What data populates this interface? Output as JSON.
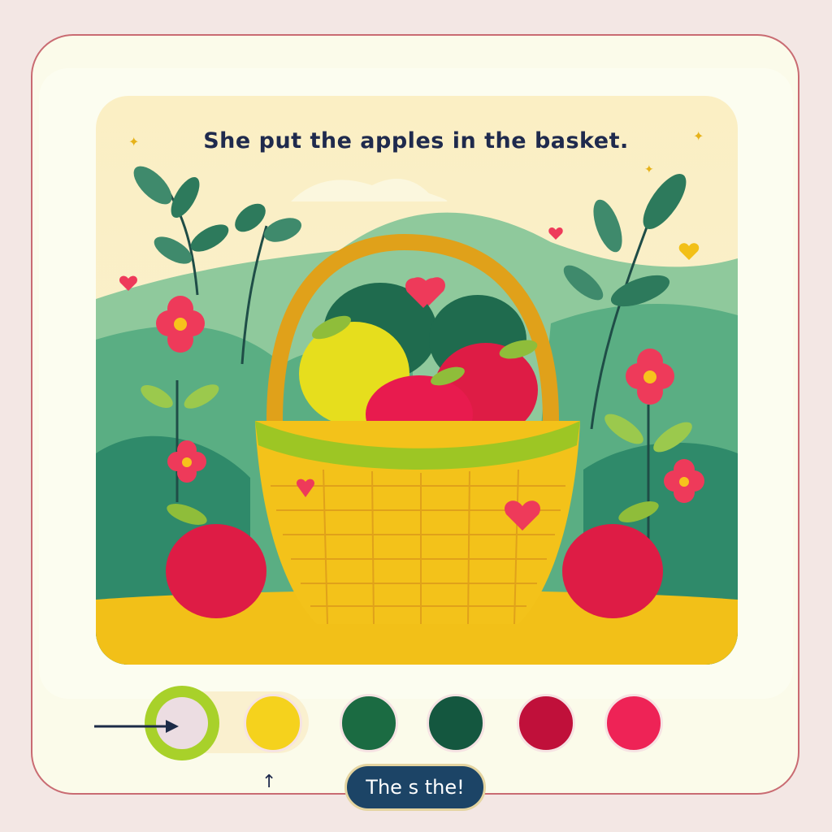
{
  "lesson": {
    "sentence": "She put the apples in the basket.",
    "answer_button_label": "The s the!"
  },
  "colors": {
    "background": "#f3e7e4",
    "frame_border": "#c96b72",
    "caption": "#1f2a4d",
    "selected_ring": "#a8d12a"
  },
  "color_swatches": [
    {
      "color": "#ecdde2",
      "selected": true,
      "icon": "arrow-pointer-icon"
    },
    {
      "color": "#f5d21d",
      "selected": false
    },
    {
      "color": "#1b6b42",
      "selected": false
    },
    {
      "color": "#14573f",
      "selected": false
    },
    {
      "color": "#c0103a",
      "selected": false
    },
    {
      "color": "#ee2356",
      "selected": false
    }
  ],
  "icons": [
    "arrow-pointer-icon",
    "up-arrow-icon",
    "heart-icon",
    "sparkle-icon"
  ]
}
